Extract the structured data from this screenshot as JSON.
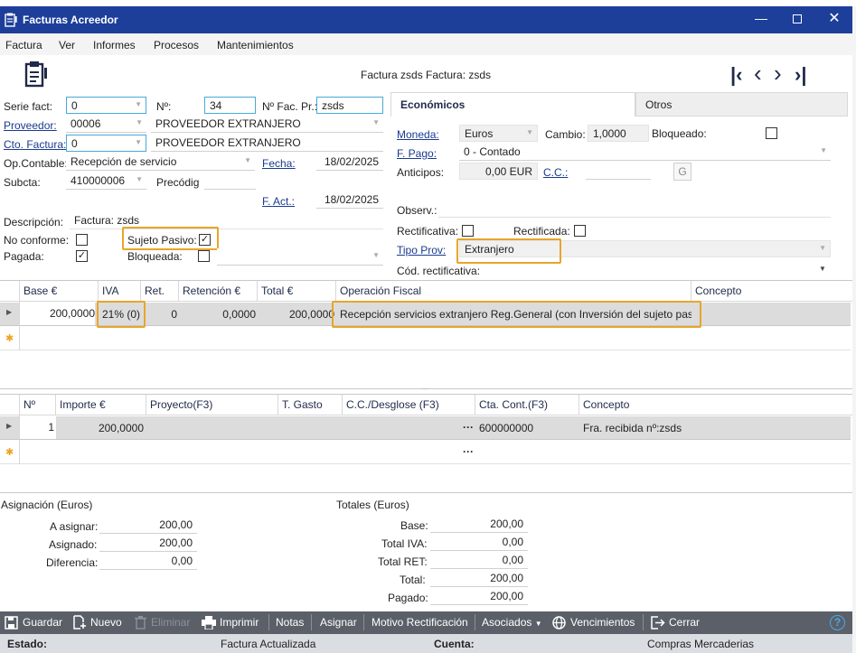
{
  "window": {
    "title": "Facturas Acreedor"
  },
  "menu": [
    "Factura",
    "Ver",
    "Informes",
    "Procesos",
    "Mantenimientos"
  ],
  "header": {
    "doc_title": "Factura zsds  Factura: zsds"
  },
  "form": {
    "serie_label": "Serie fact:",
    "serie_value": "0",
    "no_label": "Nº:",
    "no_value": "34",
    "nofac_label": "Nº Fac. Pr.:",
    "nofac_value": "zsds",
    "proveedor_label": "Proveedor:",
    "proveedor_value": "00006",
    "proveedor_name": "PROVEEDOR EXTRANJERO",
    "cto_label": "Cto. Factura:",
    "cto_value": "0",
    "cto_name": "PROVEEDOR EXTRANJERO",
    "opcontable_label": "Op.Contable:",
    "opcontable_value": "Recepción de servicio",
    "fecha_label": "Fecha:",
    "fecha_value": "18/02/2025",
    "subcta_label": "Subcta:",
    "subcta_value": "410000006",
    "precodig_label": "Precódig",
    "fact_label": "F. Act.:",
    "fact_value": "18/02/2025",
    "descripcion_label": "Descripción:",
    "descripcion_value": "Factura: zsds",
    "noconforme_label": "No conforme:",
    "sujeto_label": "Sujeto Pasivo:",
    "pagada_label": "Pagada:",
    "bloqueada_label": "Bloqueada:"
  },
  "tabs": {
    "economicos": "Económicos",
    "otros": "Otros"
  },
  "economicos": {
    "moneda_label": "Moneda:",
    "moneda_value": "Euros",
    "cambio_label": "Cambio:",
    "cambio_value": "1,0000",
    "bloqueado_label": "Bloqueado:",
    "fpago_label": "F. Pago:",
    "fpago_value": "0 - Contado",
    "anticipos_label": "Anticipos:",
    "anticipos_value": "0,00 EUR",
    "cc_label": "C.C.:",
    "g_button": "G",
    "observ_label": "Observ.:",
    "rectificativa_label": "Rectificativa:",
    "rectificada_label": "Rectificada:",
    "tipoprov_label": "Tipo Prov:",
    "tipoprov_value": "Extranjero",
    "codrect_label": "Cód. rectificativa:"
  },
  "grid1": {
    "headers": [
      "Base €",
      "IVA",
      "Ret.",
      "Retención €",
      "Total €",
      "Operación Fiscal",
      "Concepto"
    ],
    "row": {
      "base": "200,0000",
      "iva": "21% (0)",
      "ret": "0",
      "retencion": "0,0000",
      "total": "200,0000",
      "operacion": "Recepción servicios extranjero Reg.General (con Inversión del sujeto pas...",
      "concepto": ""
    }
  },
  "grid2": {
    "headers": [
      "Nº",
      "Importe €",
      "Proyecto(F3)",
      "T. Gasto",
      "C.C./Desglose (F3)",
      "Cta. Cont.(F3)",
      "Concepto"
    ],
    "row": {
      "n": "1",
      "importe": "200,0000",
      "proyecto": "",
      "tgasto": "",
      "cc": "",
      "ellipsis": "···",
      "cta": "600000000",
      "concepto": "Fra. recibida nº:zsds"
    },
    "new_ellipsis": "···"
  },
  "asignacion": {
    "title": "Asignación (Euros)",
    "a_asignar_label": "A asignar:",
    "a_asignar": "200,00",
    "asignado_label": "Asignado:",
    "asignado": "200,00",
    "diferencia_label": "Diferencia:",
    "diferencia": "0,00"
  },
  "totales": {
    "title": "Totales (Euros)",
    "base_label": "Base:",
    "base": "200,00",
    "iva_label": "Total IVA:",
    "iva": "0,00",
    "ret_label": "Total RET:",
    "ret": "0,00",
    "total_label": "Total:",
    "total": "200,00",
    "pagado_label": "Pagado:",
    "pagado": "200,00"
  },
  "toolbar": {
    "guardar": "Guardar",
    "nuevo": "Nuevo",
    "eliminar": "Eliminar",
    "imprimir": "Imprimir",
    "notas": "Notas",
    "asignar": "Asignar",
    "motivo": "Motivo Rectificación",
    "asociados": "Asociados",
    "vencimientos": "Vencimientos",
    "cerrar": "Cerrar",
    "help": "?"
  },
  "status": {
    "estado_label": "Estado:",
    "estado_value": "Factura Actualizada",
    "cuenta_label": "Cuenta:",
    "cuenta_value": "Compras Mercaderias"
  },
  "colors": {
    "titlebar": "#1d3f9a",
    "toolbar": "#5b6068",
    "highlight": "#e8a52a",
    "statusbar": "#dadde2"
  }
}
